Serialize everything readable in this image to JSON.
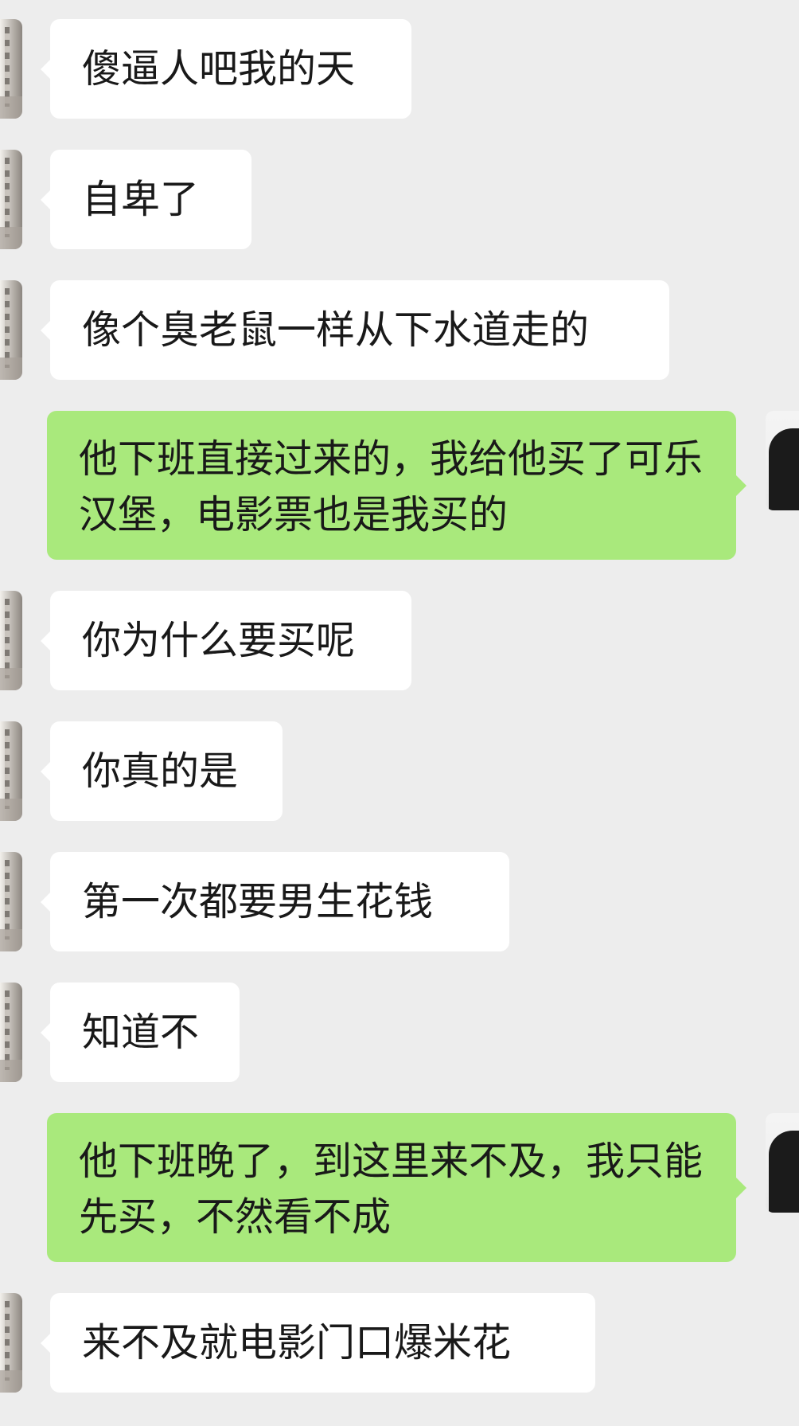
{
  "messages": [
    {
      "side": "left",
      "text": "傻逼人吧我的天"
    },
    {
      "side": "left",
      "text": "自卑了"
    },
    {
      "side": "left",
      "text": "像个臭老鼠一样从下水道走的"
    },
    {
      "side": "right",
      "text": "他下班直接过来的，我给他买了可乐汉堡，电影票也是我买的"
    },
    {
      "side": "left",
      "text": "你为什么要买呢"
    },
    {
      "side": "left",
      "text": "你真的是"
    },
    {
      "side": "left",
      "text": "第一次都要男生花钱"
    },
    {
      "side": "left",
      "text": "知道不"
    },
    {
      "side": "right",
      "text": "他下班晚了，到这里来不及，我只能先买，不然看不成"
    },
    {
      "side": "left",
      "text": "来不及就电影门口爆米花"
    }
  ]
}
